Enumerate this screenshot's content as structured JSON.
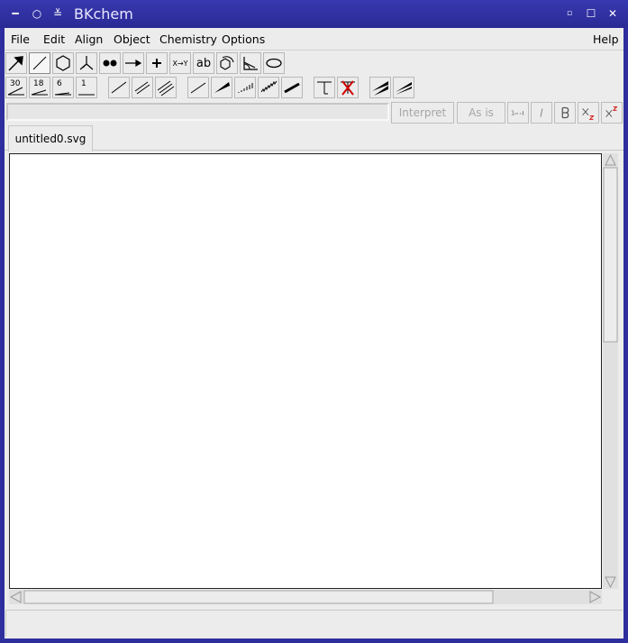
{
  "window": {
    "title": "BKchem"
  },
  "menubar": {
    "file": "File",
    "edit": "Edit",
    "align": "Align",
    "object": "Object",
    "chemistry": "Chemistry",
    "options": "Options",
    "help": "Help"
  },
  "toolbar_modes": {
    "bond_xy_label": "X→Y",
    "text_label": "ab"
  },
  "toolbar_submodes": {
    "angle_30": "30",
    "angle_18": "18",
    "angle_6": "6",
    "angle_1": "1"
  },
  "entry": {
    "value": "",
    "interpret_label": "Interpret",
    "as_is_label": "As is"
  },
  "tabs": [
    {
      "label": "untitled0.svg"
    }
  ],
  "colors": {
    "titlebar": "#2e2e9e",
    "background": "#ececec",
    "canvas": "#ffffff"
  }
}
